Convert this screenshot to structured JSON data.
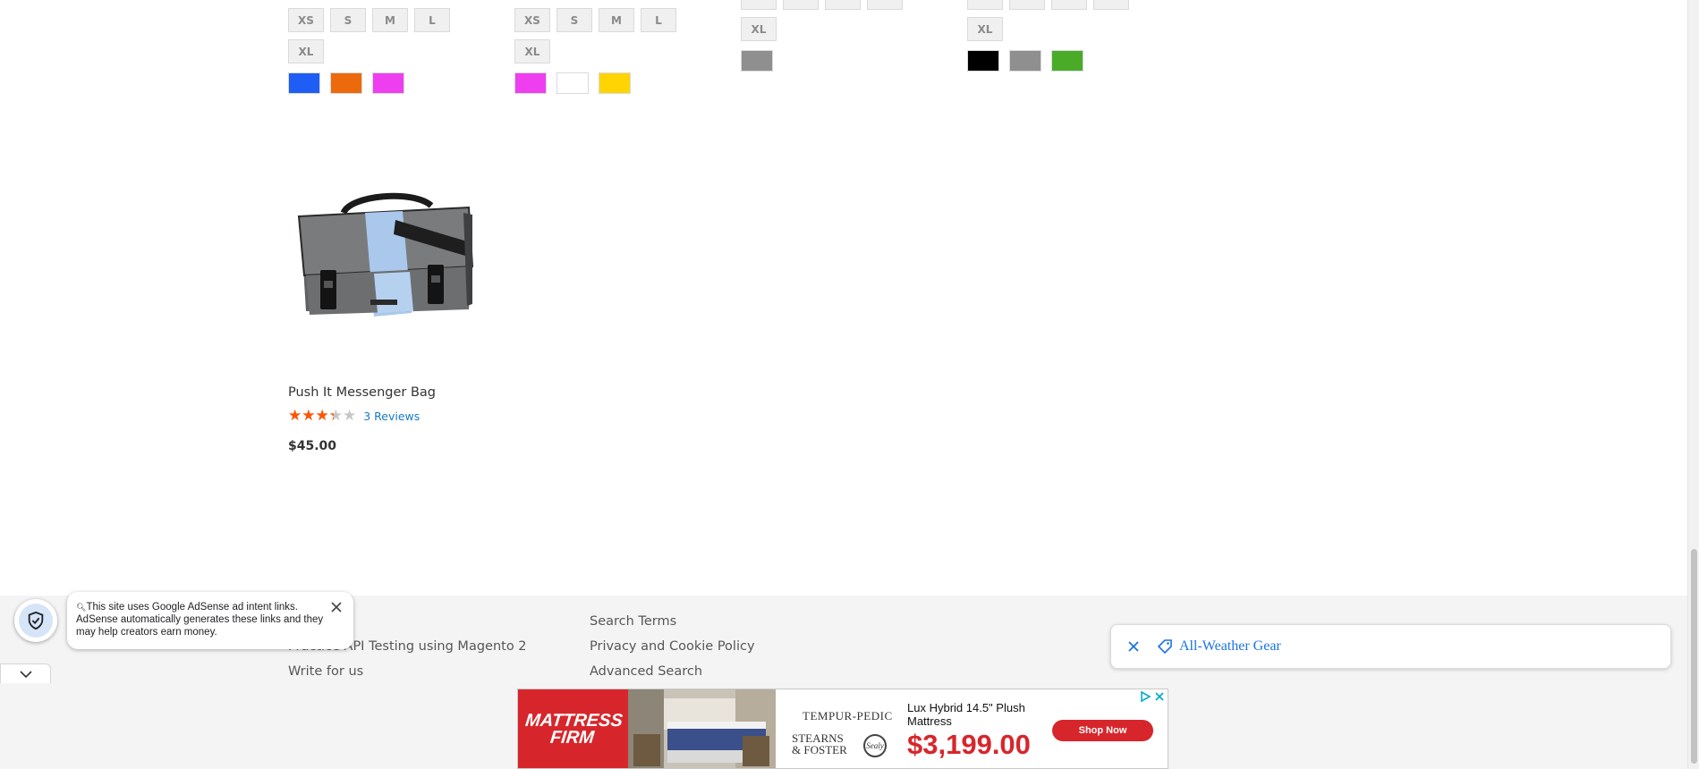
{
  "products_above": [
    {
      "sizes_row1": [
        "XS",
        "S",
        "M",
        "L"
      ],
      "sizes_row2": [
        "XL"
      ],
      "colors": [
        "#1f5ef5",
        "#ec6a0c",
        "#ef3ef0"
      ]
    },
    {
      "sizes_row1": [
        "XS",
        "S",
        "M",
        "L"
      ],
      "sizes_row2": [
        "XL"
      ],
      "colors": [
        "#ef3ef0",
        "#ffffff",
        "#ffd400"
      ]
    },
    {
      "sizes_row2": [
        "XL"
      ],
      "colors": [
        "#8f8f8f"
      ]
    },
    {
      "sizes_row2": [
        "XL"
      ],
      "colors": [
        "#000000",
        "#8f8f8f",
        "#4aab29"
      ]
    }
  ],
  "product_card": {
    "name": "Push It Messenger Bag",
    "rating_fraction": 0.67,
    "reviews_label": "3 Reviews",
    "price": "$45.00",
    "image_icon": "messenger-bag-image"
  },
  "footer": {
    "col1": [
      "Practice API Testing using Magento 2",
      "Write for us"
    ],
    "col2": [
      "Search Terms",
      "Privacy and Cookie Policy",
      "Advanced Search"
    ]
  },
  "adsense_notice": {
    "text": "This site uses Google AdSense ad intent links. AdSense automatically generates these links and they may help creators earn money."
  },
  "related_search": {
    "label": "All-Weather Gear"
  },
  "bottom_ad": {
    "brand": "MATTRESS FIRM",
    "logo_tempur": "TEMPUR-PEDIC",
    "logo_stearns": "STEARNS & FOSTER",
    "logo_sealy": "Sealy",
    "headline": "Lux Hybrid 14.5\" Plush Mattress",
    "price": "$3,199.00",
    "cta": "Shop Now",
    "brand_color": "#d7262b"
  },
  "colors": {
    "star": "#ff5501",
    "link": "#1979c3",
    "footer_bg": "#f4f4f4"
  }
}
